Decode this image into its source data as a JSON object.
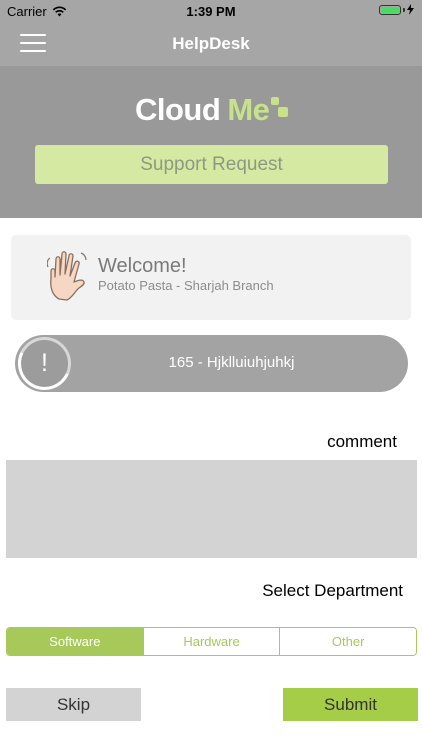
{
  "status_bar": {
    "carrier": "Carrier",
    "time": "1:39 PM",
    "icons": [
      "wifi-icon",
      "battery-icon",
      "charging-bolt-icon"
    ]
  },
  "nav": {
    "title": "HelpDesk",
    "menu_icon": "hamburger-menu-icon"
  },
  "logo": {
    "part1": "Cloud",
    "part2": "Me"
  },
  "header": {
    "support_button": "Support Request"
  },
  "welcome": {
    "icon": "waving-hand-icon",
    "title": "Welcome!",
    "subtitle": "Potato Pasta - Sharjah Branch"
  },
  "ticket": {
    "icon": "exclamation-icon",
    "icon_glyph": "!",
    "text": "165 - Hjklluiuhjuhkj"
  },
  "comment": {
    "label": "comment",
    "value": ""
  },
  "department": {
    "label": "Select Department",
    "options": [
      "Software",
      "Hardware",
      "Other"
    ],
    "selected": "Software"
  },
  "actions": {
    "skip": "Skip",
    "submit": "Submit"
  },
  "colors": {
    "accent_green": "#a5cd48",
    "light_green": "#d6e9a3",
    "header_gray": "#999999",
    "nav_gray": "#a6a6a6"
  }
}
